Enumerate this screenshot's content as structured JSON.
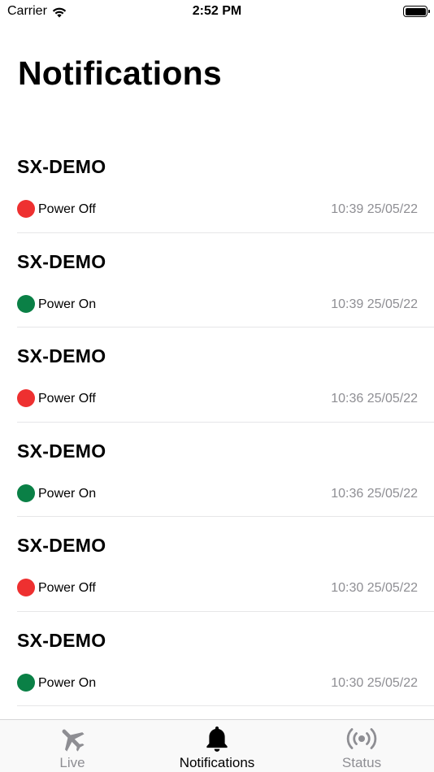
{
  "status_bar": {
    "carrier": "Carrier",
    "time": "2:52 PM"
  },
  "page": {
    "title": "Notifications"
  },
  "colors": {
    "off": "#ee3030",
    "on": "#0a8046",
    "active_tab": "#000000",
    "inactive_tab": "#8e8e93"
  },
  "notifications": [
    {
      "device": "SX-DEMO",
      "event": "Power Off",
      "status": "off",
      "time": "10:39 25/05/22"
    },
    {
      "device": "SX-DEMO",
      "event": "Power On",
      "status": "on",
      "time": "10:39 25/05/22"
    },
    {
      "device": "SX-DEMO",
      "event": "Power Off",
      "status": "off",
      "time": "10:36 25/05/22"
    },
    {
      "device": "SX-DEMO",
      "event": "Power On",
      "status": "on",
      "time": "10:36 25/05/22"
    },
    {
      "device": "SX-DEMO",
      "event": "Power Off",
      "status": "off",
      "time": "10:30 25/05/22"
    },
    {
      "device": "SX-DEMO",
      "event": "Power On",
      "status": "on",
      "time": "10:30 25/05/22"
    }
  ],
  "tabs": [
    {
      "label": "Live",
      "icon": "airplane-icon",
      "active": false
    },
    {
      "label": "Notifications",
      "icon": "bell-icon",
      "active": true
    },
    {
      "label": "Status",
      "icon": "broadcast-icon",
      "active": false
    }
  ]
}
